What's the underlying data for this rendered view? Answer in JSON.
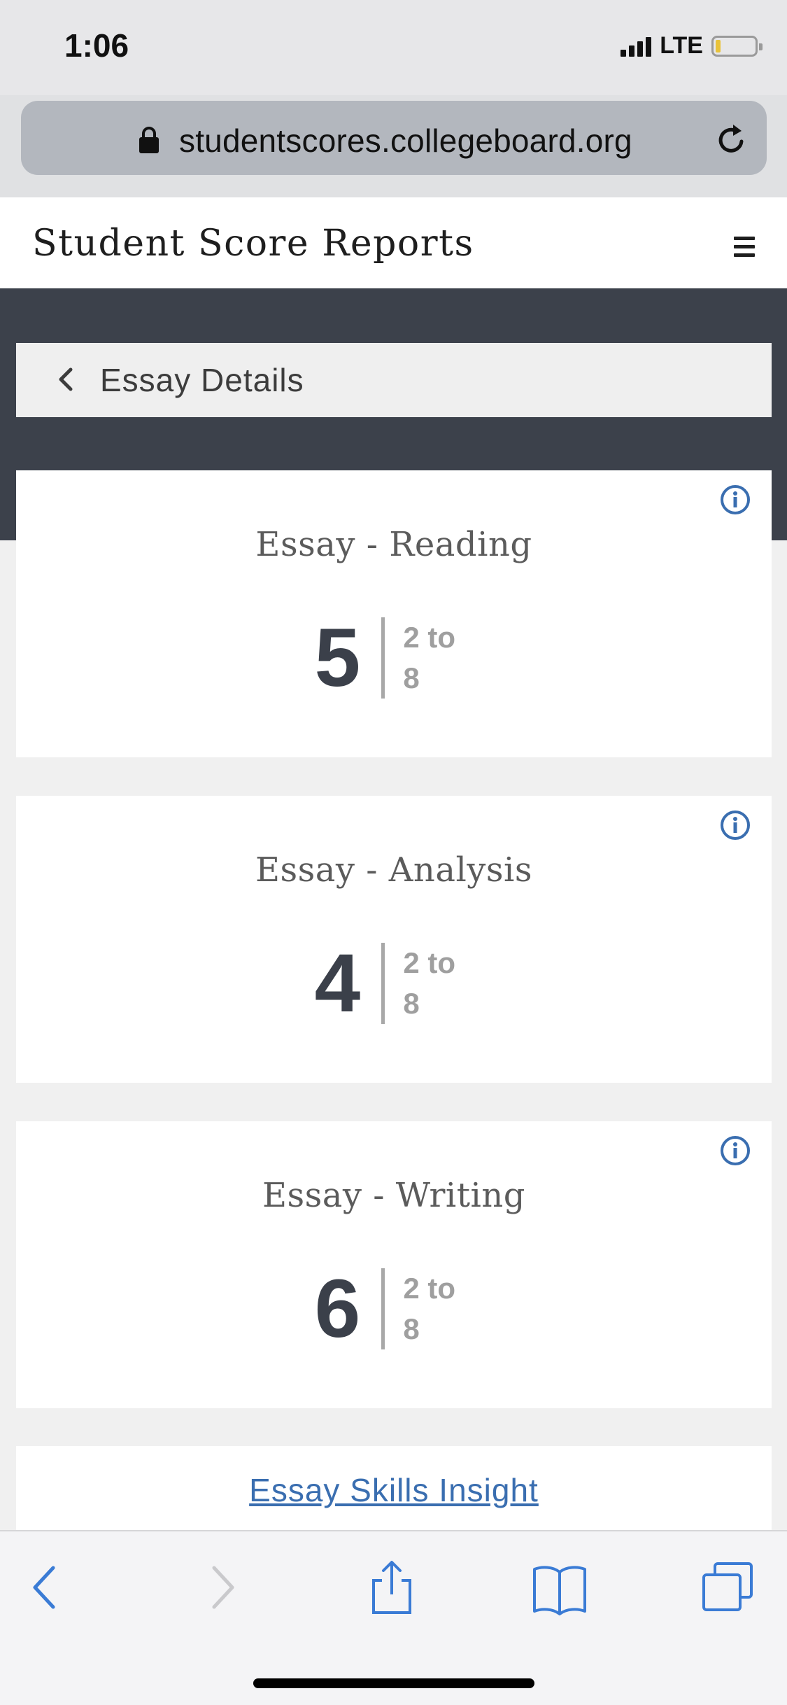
{
  "status_bar": {
    "time": "1:06",
    "network": "LTE",
    "battery_level": 0.1
  },
  "browser": {
    "url": "studentscores.collegeboard.org"
  },
  "header": {
    "title": "Student Score Reports"
  },
  "nav": {
    "back_label": "Essay Details"
  },
  "scores": [
    {
      "title": "Essay - Reading",
      "score": "5",
      "range_line1": "2 to",
      "range_line2": "8"
    },
    {
      "title": "Essay - Analysis",
      "score": "4",
      "range_line1": "2 to",
      "range_line2": "8"
    },
    {
      "title": "Essay - Writing",
      "score": "6",
      "range_line1": "2 to",
      "range_line2": "8"
    }
  ],
  "insight": {
    "link_label": "Essay Skills Insight"
  },
  "colors": {
    "accent": "#3a6eb0",
    "dark_band": "#3c414b",
    "score_text": "#3b404a"
  }
}
